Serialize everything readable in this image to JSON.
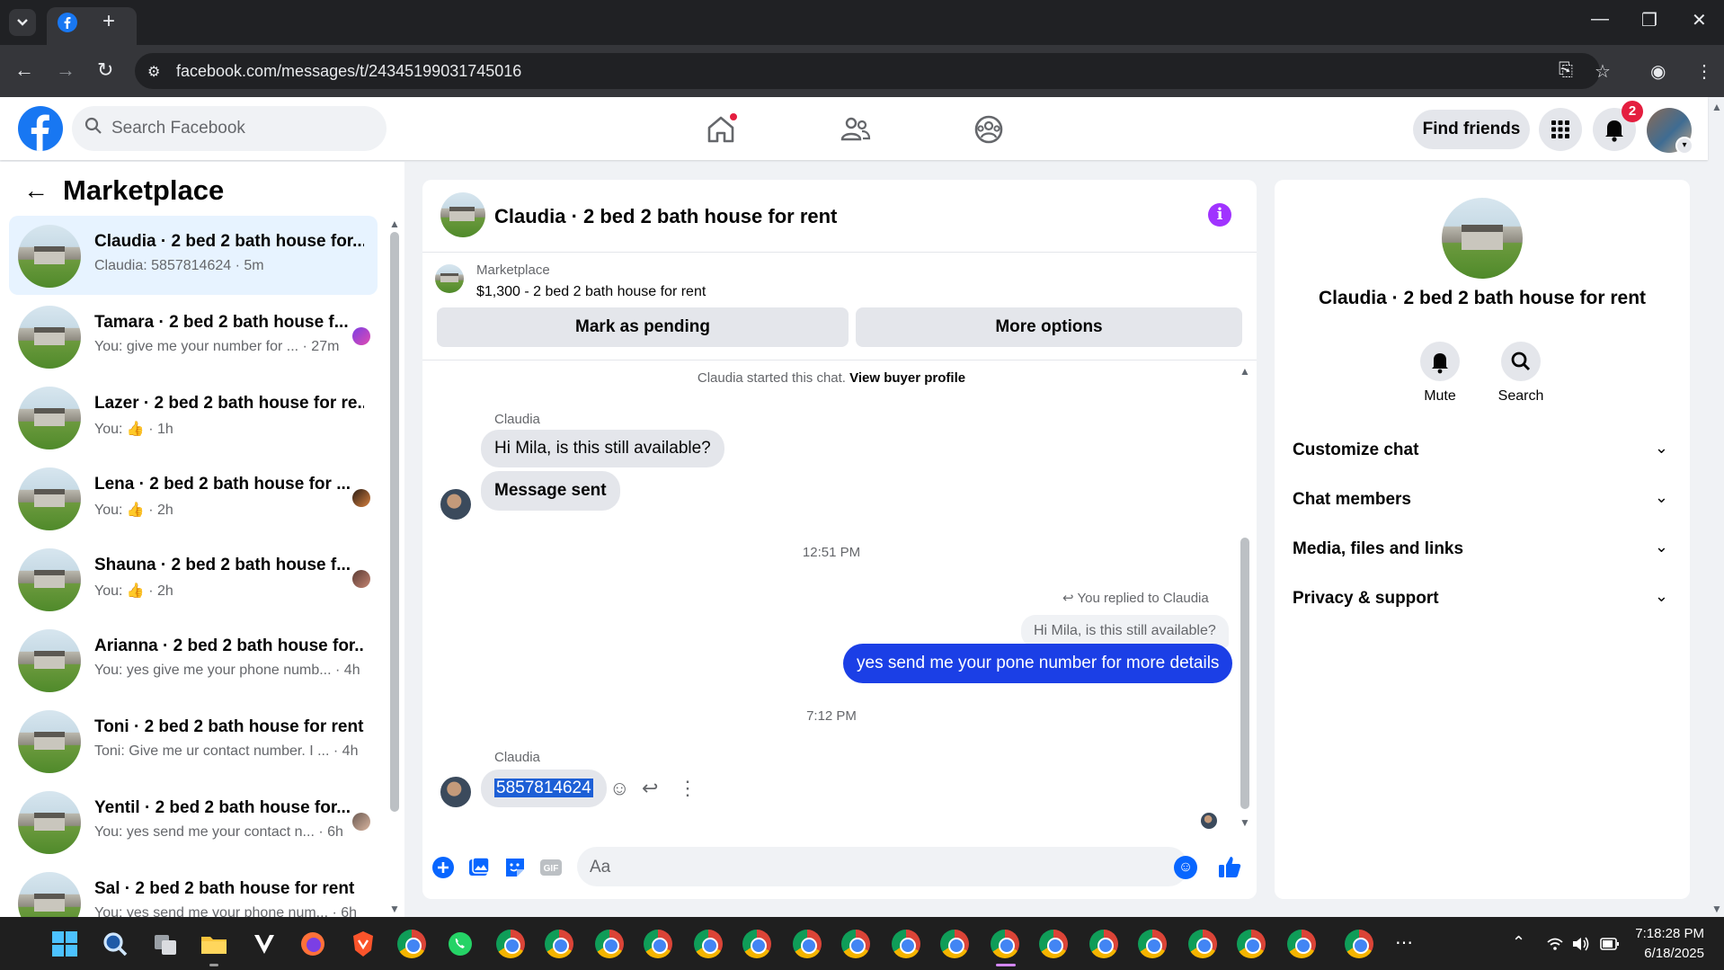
{
  "browser": {
    "url": "facebook.com/messages/t/24345199031745016",
    "new_tab": "+",
    "minimize": "—",
    "maximize": "❐",
    "close": "✕"
  },
  "header": {
    "search_placeholder": "Search Facebook",
    "find_friends": "Find friends",
    "notification_count": "2"
  },
  "left_panel": {
    "title": "Marketplace",
    "conversations": [
      {
        "name": "Claudia · 2 bed 2 bath house for...",
        "snippet": "Claudia: 5857814624 · 5m",
        "active": true
      },
      {
        "name": "Tamara · 2 bed 2 bath house f...",
        "snippet": "You: give me your number for ... · 27m"
      },
      {
        "name": "Lazer · 2 bed 2 bath house for re...",
        "snippet": "You: 👍 · 1h"
      },
      {
        "name": "Lena · 2 bed 2 bath house for ...",
        "snippet": "You: 👍 · 2h"
      },
      {
        "name": "Shauna · 2 bed 2 bath house f...",
        "snippet": "You: 👍 · 2h"
      },
      {
        "name": "Arianna · 2 bed 2 bath house for...",
        "snippet": "You: yes give me your phone numb... · 4h"
      },
      {
        "name": "Toni · 2 bed 2 bath house for rent",
        "snippet": "Toni: Give me ur contact number. I ... · 4h"
      },
      {
        "name": "Yentil · 2 bed 2 bath house for...",
        "snippet": "You: yes send me your contact n... · 6h"
      },
      {
        "name": "Sal · 2 bed 2 bath house for rent",
        "snippet": "You: yes send me your phone num... · 6h"
      }
    ]
  },
  "chat": {
    "title": "Claudia · 2 bed 2 bath house for rent",
    "marketplace_label": "Marketplace",
    "listing": "$1,300 - 2 bed 2 bath house for rent",
    "mark_pending": "Mark as pending",
    "more_options": "More options",
    "started_text": "Claudia started this chat.",
    "view_profile": "View buyer profile",
    "sender1": "Claudia",
    "msg1": "Hi Mila, is this still available?",
    "msg2": "Message sent",
    "time1": "12:51 PM",
    "replied_to": "You replied to Claudia",
    "reply_quote": "Hi Mila, is this still available?",
    "msg3": "yes send me your pone number for more details",
    "time2": "7:12 PM",
    "sender2": "Claudia",
    "msg4": "5857814624",
    "composer_placeholder": "Aa"
  },
  "right_panel": {
    "title": "Claudia · 2 bed 2 bath house for rent",
    "mute": "Mute",
    "search": "Search",
    "sections": [
      "Customize chat",
      "Chat members",
      "Media, files and links",
      "Privacy & support"
    ]
  },
  "taskbar": {
    "time": "7:18:28 PM",
    "date": "6/18/2025"
  },
  "colors": {
    "accent": "#1877f2",
    "outgoing_bubble": "#1b3fe6",
    "active_conversation": "#e7f3ff",
    "info_icon": "#a033ff"
  }
}
